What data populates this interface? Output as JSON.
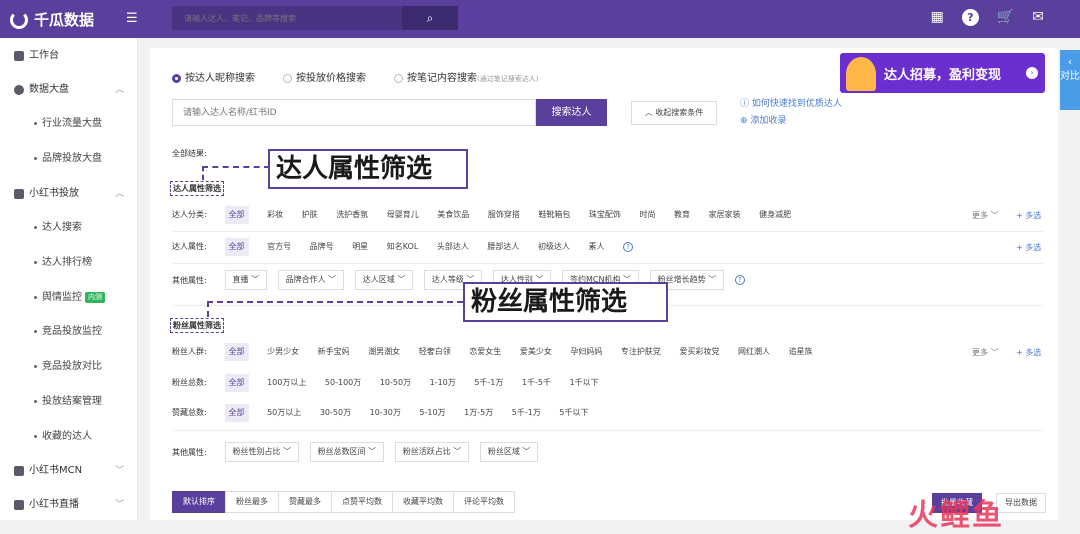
{
  "app": {
    "name": "千瓜数据"
  },
  "topbar": {
    "search_placeholder": "请输入达人、笔记、品牌等搜索",
    "search_icon": "search-icon",
    "icons": [
      "grid-icon",
      "help-icon",
      "cart-icon",
      "mail-icon"
    ],
    "help_glyph": "?"
  },
  "sidebar": {
    "items": [
      {
        "label": "工作台",
        "icon": "dashboard-icon"
      },
      {
        "label": "数据大盘",
        "icon": "chart-icon",
        "chevron": "︿"
      },
      {
        "label": "行业流量大盘"
      },
      {
        "label": "品牌投放大盘"
      },
      {
        "label": "小红书投放",
        "icon": "redbook-icon",
        "chevron": "︿"
      },
      {
        "label": "达人搜索"
      },
      {
        "label": "达人排行榜"
      },
      {
        "label": "舆情监控",
        "badge": "内测"
      },
      {
        "label": "竞品投放监控"
      },
      {
        "label": "竞品投放对比"
      },
      {
        "label": "投放结案管理"
      },
      {
        "label": "收藏的达人"
      },
      {
        "label": "小红书MCN",
        "icon": "mcn-icon",
        "chevron": "﹀"
      },
      {
        "label": "小红书直播",
        "icon": "live-icon",
        "chevron": "﹀"
      }
    ]
  },
  "search_tabs": [
    {
      "label": "按达人昵称搜索",
      "selected": true
    },
    {
      "label": "按投放价格搜索",
      "selected": false
    },
    {
      "label": "按笔记内容搜索",
      "note": "(通过笔记搜索达人)",
      "selected": false
    }
  ],
  "banner": {
    "text": "达人招募，盈利变现",
    "arrow": "›"
  },
  "keyword": {
    "placeholder": "请输入达人名称/红书ID",
    "button": "搜索达人",
    "collapse": "收起搜索条件",
    "collapse_icon": "︿"
  },
  "help_links": {
    "howto": "如何快速找到优质达人",
    "add": "添加收录"
  },
  "results_label": "全部结果:",
  "sections": {
    "influencer_title": "达人属性筛选",
    "influencer_callout": "达人属性筛选",
    "fan_title": "粉丝属性筛选",
    "fan_callout": "粉丝属性筛选"
  },
  "filters": {
    "category": {
      "label": "达人分类:",
      "options": [
        "全部",
        "彩妆",
        "护肤",
        "洗护香氛",
        "母婴育儿",
        "美食饮品",
        "服饰穿搭",
        "鞋靴箱包",
        "珠宝配饰",
        "时尚",
        "教育",
        "家居家装",
        "健身减肥"
      ],
      "more": "更多 ﹀",
      "multi": "+ 多选"
    },
    "attribute": {
      "label": "达人属性:",
      "options": [
        "全部",
        "官方号",
        "品牌号",
        "明星",
        "知名KOL",
        "头部达人",
        "腰部达人",
        "初级达人",
        "素人"
      ],
      "multi": "+ 多选",
      "help": "?"
    },
    "other": {
      "label": "其他属性:",
      "selects": [
        "直播 ﹀",
        "品牌合作人 ﹀",
        "达人区域 ﹀",
        "达人等级 ﹀",
        "达人性别 ﹀",
        "签约MCN机构 ﹀",
        "粉丝增长趋势 ﹀"
      ],
      "help": "?"
    },
    "fan_crowd": {
      "label": "粉丝人群:",
      "options": [
        "全部",
        "少男少女",
        "新手宝妈",
        "潮男潮女",
        "轻奢白领",
        "恋爱女生",
        "爱美少女",
        "孕妇妈妈",
        "专注护肤党",
        "爱买彩妆党",
        "网红潮人",
        "追星族"
      ],
      "more": "更多 ﹀",
      "multi": "+ 多选"
    },
    "fan_total": {
      "label": "粉丝总数:",
      "options": [
        "全部",
        "100万以上",
        "50-100万",
        "10-50万",
        "1-10万",
        "5千-1万",
        "1千-5千",
        "1千以下"
      ]
    },
    "likes_total": {
      "label": "赞藏总数:",
      "options": [
        "全部",
        "50万以上",
        "30-50万",
        "10-30万",
        "5-10万",
        "1万-5万",
        "5千-1万",
        "5千以下"
      ]
    },
    "fan_other": {
      "label": "其他属性:",
      "selects": [
        "粉丝性别占比 ﹀",
        "粉丝总数区间 ﹀",
        "粉丝活跃占比 ﹀",
        "粉丝区域 ﹀"
      ]
    }
  },
  "sort_tabs": [
    "默认排序",
    "粉丝最多",
    "赞藏最多",
    "点赞平均数",
    "收藏平均数",
    "评论平均数"
  ],
  "export": {
    "batch": "批量收藏",
    "export": "导出数据"
  },
  "side_tab": {
    "arrow": "‹",
    "label": "对比"
  },
  "watermark": "火鲤鱼",
  "colors": {
    "brand": "#5b3f9c",
    "link": "#4a7bd0",
    "badge": "#2fb65a"
  }
}
